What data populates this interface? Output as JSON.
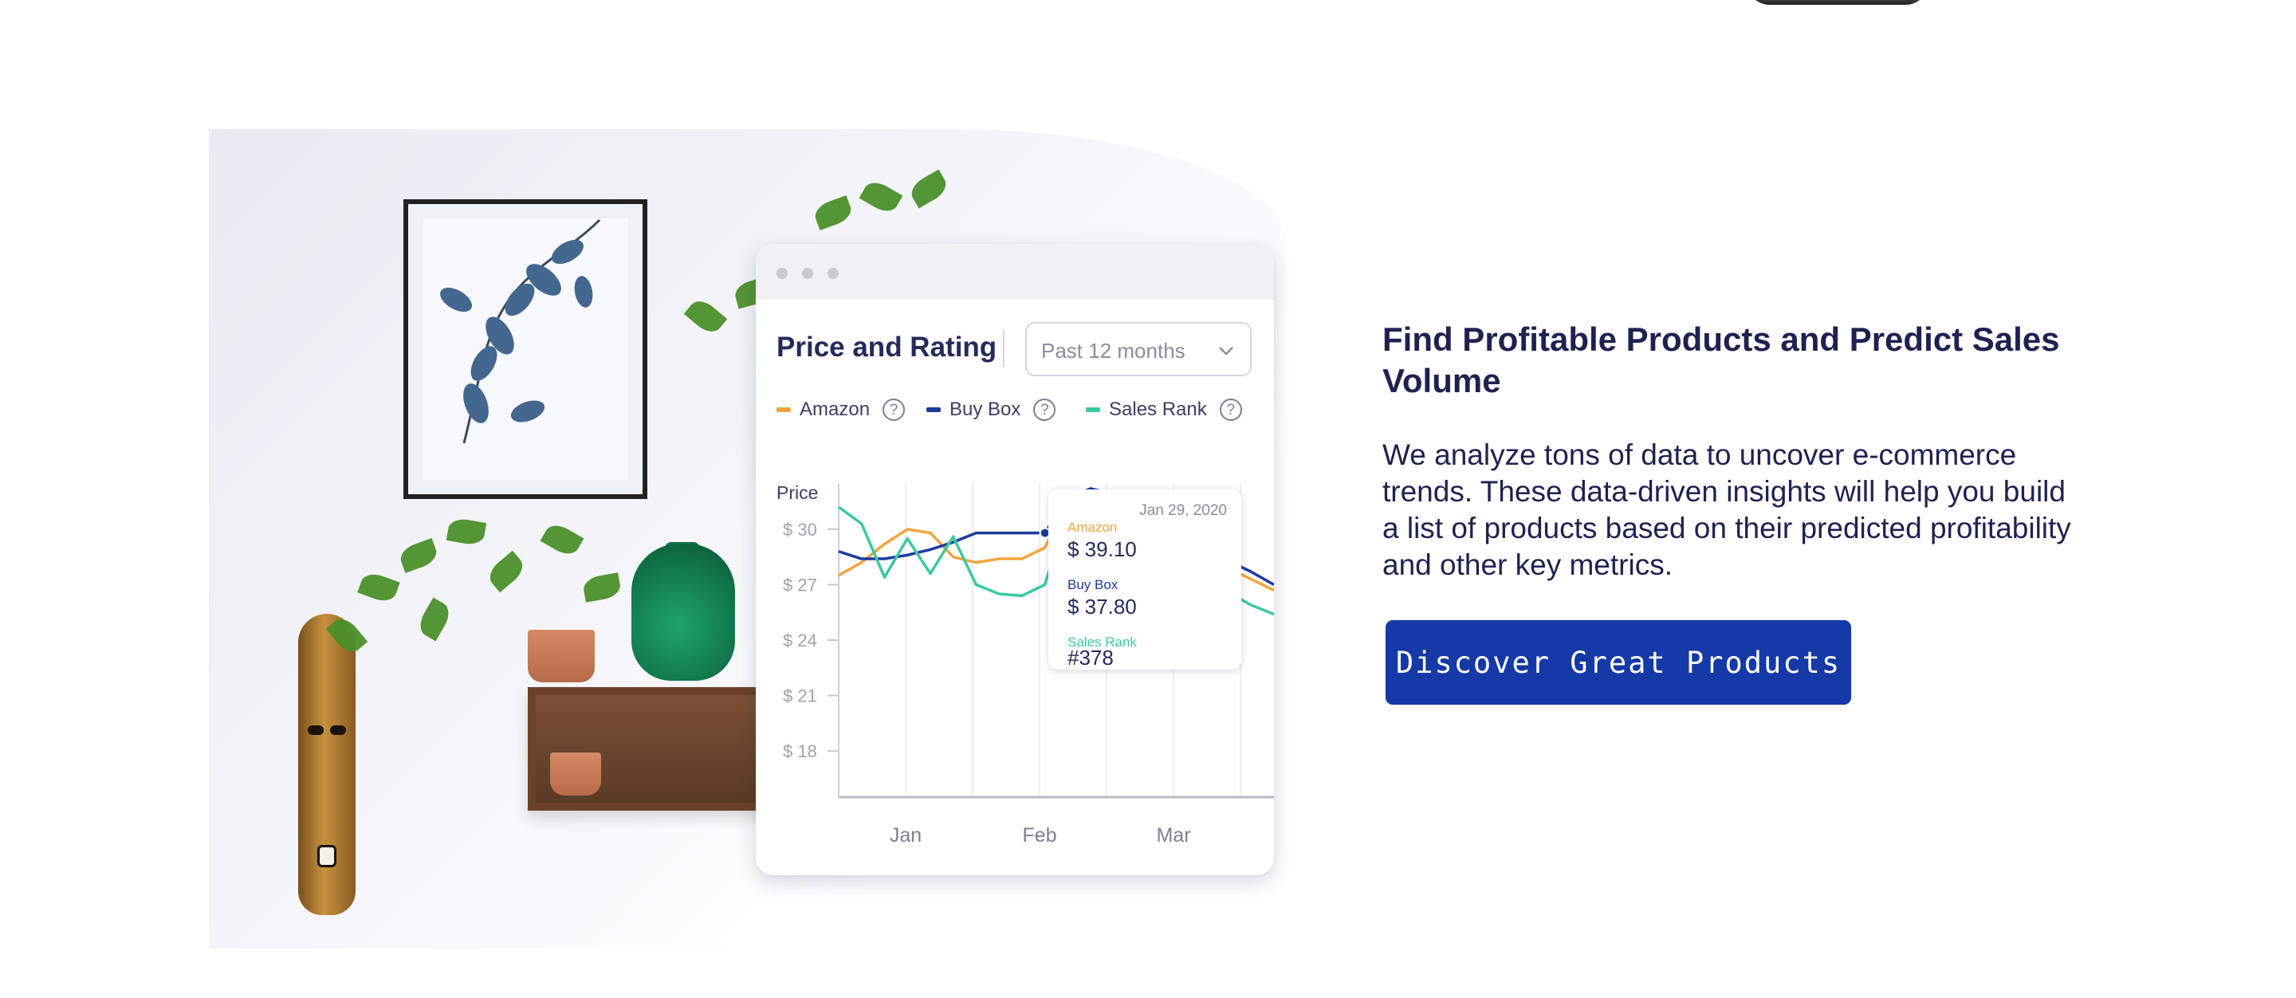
{
  "card": {
    "title": "Price and Rating",
    "range_select": "Past 12 months",
    "legend": [
      {
        "label": "Amazon",
        "color": "#f3a53c"
      },
      {
        "label": "Buy Box",
        "color": "#1e3a9e"
      },
      {
        "label": "Sales Rank",
        "color": "#3cc9a0"
      }
    ],
    "help_glyph": "?"
  },
  "chart_data": {
    "type": "line",
    "ylabel": "Price",
    "y_ticks": [
      "$ 30",
      "$ 27",
      "$ 24",
      "$ 21",
      "$ 18"
    ],
    "x_ticks": [
      "Jan",
      "Feb",
      "Mar"
    ],
    "series": [
      {
        "name": "Amazon",
        "color": "#f3a53c",
        "values": [
          27.5,
          28.2,
          29.2,
          30,
          29.8,
          28.5,
          28.2,
          28.4,
          28.4,
          29.0,
          31.5,
          32.2,
          31.8,
          31.0,
          30.2,
          29.4,
          28.6,
          27.9,
          27.3,
          26.7
        ]
      },
      {
        "name": "Buy Box",
        "color": "#1e3a9e",
        "values": [
          28.8,
          28.4,
          28.4,
          28.6,
          28.9,
          29.3,
          29.8,
          29.8,
          29.8,
          29.8,
          31.7,
          32.2,
          31.9,
          31.2,
          30.4,
          29.6,
          28.9,
          28.3,
          27.7,
          27.0
        ]
      },
      {
        "name": "Sales Rank",
        "color": "#3cc9a0",
        "values": [
          31.2,
          30.3,
          27.4,
          29.5,
          27.6,
          29.6,
          27.0,
          26.5,
          26.4,
          27.0,
          31.0,
          31.6,
          31.0,
          30.0,
          29.0,
          28.0,
          27.2,
          26.6,
          25.9,
          25.4
        ]
      }
    ],
    "x_range": [
      0,
      19
    ],
    "ylim": [
      15.5,
      32.5
    ],
    "tooltip": {
      "date": "Jan 29, 2020",
      "items": [
        {
          "label": "Amazon",
          "value": "$ 39.10",
          "color": "#f3a53c"
        },
        {
          "label": "Buy Box",
          "value": "$ 37.80",
          "color": "#1e3a9e"
        },
        {
          "label": "Sales Rank",
          "value": "#378",
          "color": "#3cc9a0"
        }
      ]
    }
  },
  "section": {
    "heading": "Find Profitable Products and Predict Sales Volume",
    "description": "We analyze tons of data to uncover e-commerce trends. These data-driven insights will help you build a list of products based on their predicted profitability and other key metrics.",
    "cta_label": "Discover Great Products",
    "cta_color": "#1539a6"
  },
  "icons": {
    "help": "question-circle-icon",
    "dropdown": "chevron-down-icon"
  }
}
